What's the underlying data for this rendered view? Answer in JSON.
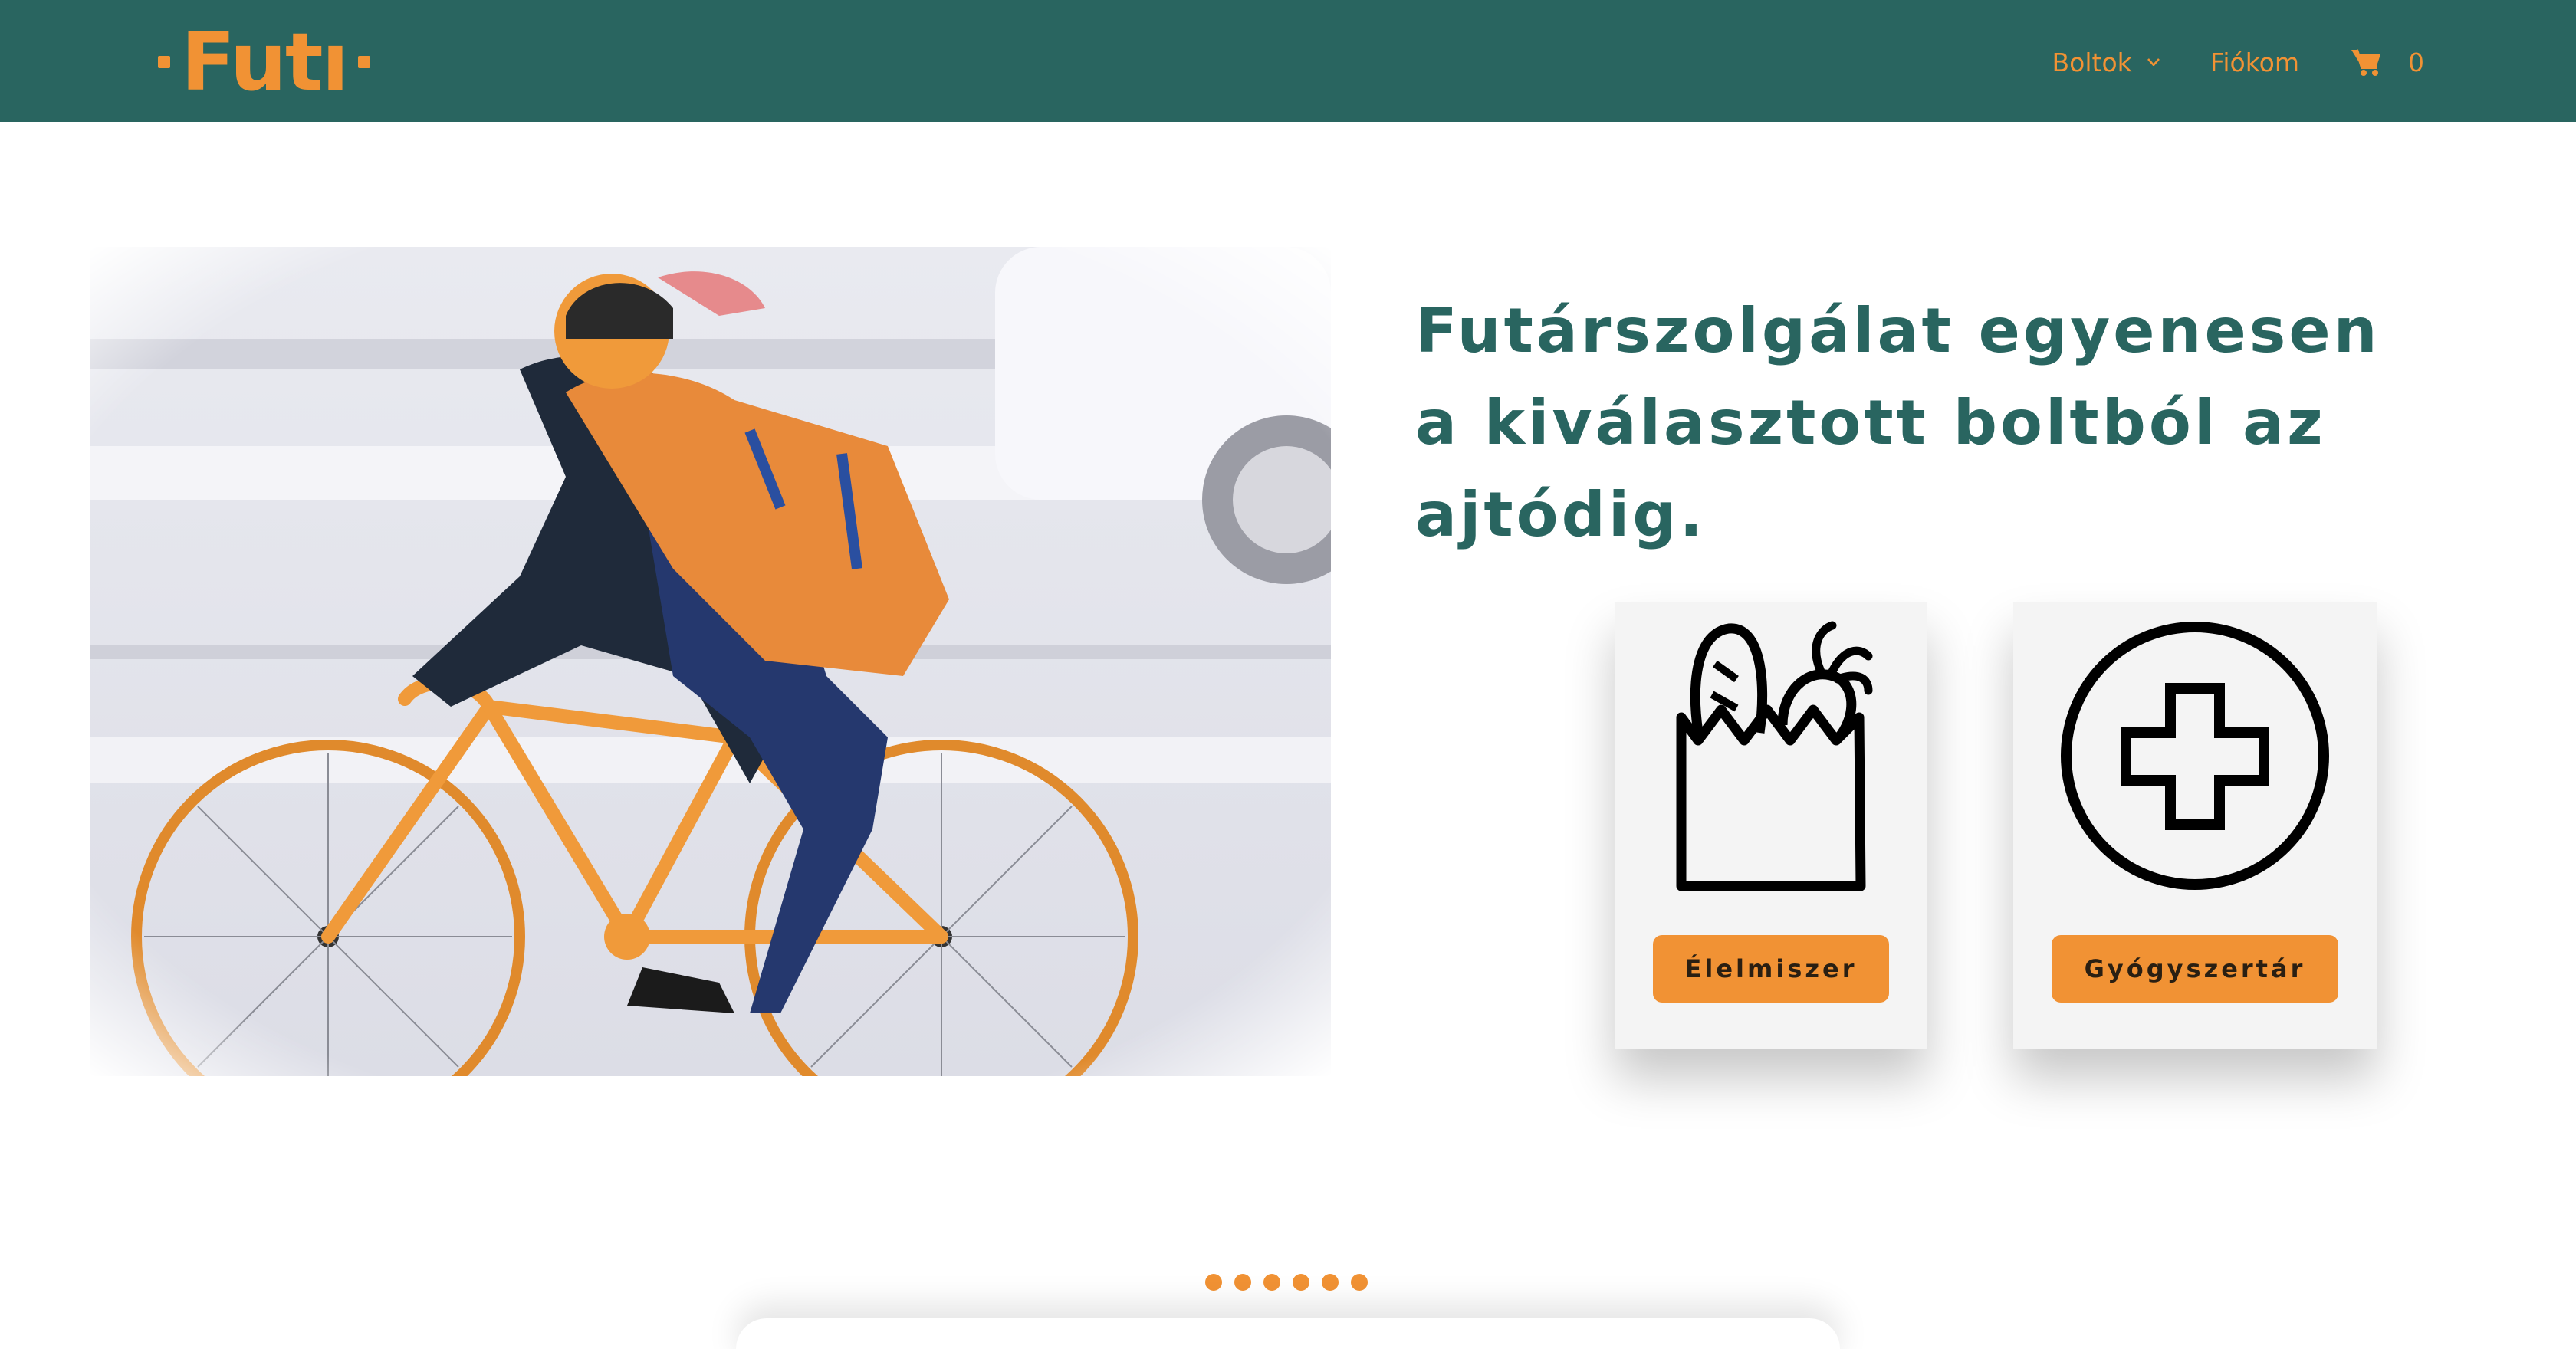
{
  "header": {
    "logo_text": "Futı",
    "nav": {
      "shops_label": "Boltok",
      "account_label": "Fiókom",
      "cart_count": "0"
    }
  },
  "hero": {
    "headline": "Futárszolgálat egyenesen a kiválasztott boltból az ajtódig."
  },
  "categories": [
    {
      "label": "Élelmiszer",
      "icon": "grocery-bag-icon"
    },
    {
      "label": "Gyógyszertár",
      "icon": "pharmacy-cross-icon"
    }
  ],
  "carousel": {
    "dot_count": 6
  },
  "colors": {
    "brand_green": "#296560",
    "accent_orange": "#f19234",
    "card_bg": "#f4f4f4"
  }
}
